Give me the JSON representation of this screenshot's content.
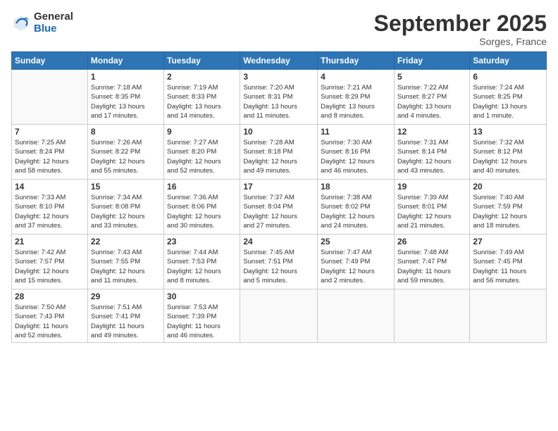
{
  "logo": {
    "general": "General",
    "blue": "Blue"
  },
  "header": {
    "month": "September 2025",
    "location": "Sorges, France"
  },
  "weekdays": [
    "Sunday",
    "Monday",
    "Tuesday",
    "Wednesday",
    "Thursday",
    "Friday",
    "Saturday"
  ],
  "weeks": [
    [
      {
        "day": "",
        "info": ""
      },
      {
        "day": "1",
        "info": "Sunrise: 7:18 AM\nSunset: 8:35 PM\nDaylight: 13 hours\nand 17 minutes."
      },
      {
        "day": "2",
        "info": "Sunrise: 7:19 AM\nSunset: 8:33 PM\nDaylight: 13 hours\nand 14 minutes."
      },
      {
        "day": "3",
        "info": "Sunrise: 7:20 AM\nSunset: 8:31 PM\nDaylight: 13 hours\nand 11 minutes."
      },
      {
        "day": "4",
        "info": "Sunrise: 7:21 AM\nSunset: 8:29 PM\nDaylight: 13 hours\nand 8 minutes."
      },
      {
        "day": "5",
        "info": "Sunrise: 7:22 AM\nSunset: 8:27 PM\nDaylight: 13 hours\nand 4 minutes."
      },
      {
        "day": "6",
        "info": "Sunrise: 7:24 AM\nSunset: 8:25 PM\nDaylight: 13 hours\nand 1 minute."
      }
    ],
    [
      {
        "day": "7",
        "info": "Sunrise: 7:25 AM\nSunset: 8:24 PM\nDaylight: 12 hours\nand 58 minutes."
      },
      {
        "day": "8",
        "info": "Sunrise: 7:26 AM\nSunset: 8:22 PM\nDaylight: 12 hours\nand 55 minutes."
      },
      {
        "day": "9",
        "info": "Sunrise: 7:27 AM\nSunset: 8:20 PM\nDaylight: 12 hours\nand 52 minutes."
      },
      {
        "day": "10",
        "info": "Sunrise: 7:28 AM\nSunset: 8:18 PM\nDaylight: 12 hours\nand 49 minutes."
      },
      {
        "day": "11",
        "info": "Sunrise: 7:30 AM\nSunset: 8:16 PM\nDaylight: 12 hours\nand 46 minutes."
      },
      {
        "day": "12",
        "info": "Sunrise: 7:31 AM\nSunset: 8:14 PM\nDaylight: 12 hours\nand 43 minutes."
      },
      {
        "day": "13",
        "info": "Sunrise: 7:32 AM\nSunset: 8:12 PM\nDaylight: 12 hours\nand 40 minutes."
      }
    ],
    [
      {
        "day": "14",
        "info": "Sunrise: 7:33 AM\nSunset: 8:10 PM\nDaylight: 12 hours\nand 37 minutes."
      },
      {
        "day": "15",
        "info": "Sunrise: 7:34 AM\nSunset: 8:08 PM\nDaylight: 12 hours\nand 33 minutes."
      },
      {
        "day": "16",
        "info": "Sunrise: 7:36 AM\nSunset: 8:06 PM\nDaylight: 12 hours\nand 30 minutes."
      },
      {
        "day": "17",
        "info": "Sunrise: 7:37 AM\nSunset: 8:04 PM\nDaylight: 12 hours\nand 27 minutes."
      },
      {
        "day": "18",
        "info": "Sunrise: 7:38 AM\nSunset: 8:02 PM\nDaylight: 12 hours\nand 24 minutes."
      },
      {
        "day": "19",
        "info": "Sunrise: 7:39 AM\nSunset: 8:01 PM\nDaylight: 12 hours\nand 21 minutes."
      },
      {
        "day": "20",
        "info": "Sunrise: 7:40 AM\nSunset: 7:59 PM\nDaylight: 12 hours\nand 18 minutes."
      }
    ],
    [
      {
        "day": "21",
        "info": "Sunrise: 7:42 AM\nSunset: 7:57 PM\nDaylight: 12 hours\nand 15 minutes."
      },
      {
        "day": "22",
        "info": "Sunrise: 7:43 AM\nSunset: 7:55 PM\nDaylight: 12 hours\nand 11 minutes."
      },
      {
        "day": "23",
        "info": "Sunrise: 7:44 AM\nSunset: 7:53 PM\nDaylight: 12 hours\nand 8 minutes."
      },
      {
        "day": "24",
        "info": "Sunrise: 7:45 AM\nSunset: 7:51 PM\nDaylight: 12 hours\nand 5 minutes."
      },
      {
        "day": "25",
        "info": "Sunrise: 7:47 AM\nSunset: 7:49 PM\nDaylight: 12 hours\nand 2 minutes."
      },
      {
        "day": "26",
        "info": "Sunrise: 7:48 AM\nSunset: 7:47 PM\nDaylight: 11 hours\nand 59 minutes."
      },
      {
        "day": "27",
        "info": "Sunrise: 7:49 AM\nSunset: 7:45 PM\nDaylight: 11 hours\nand 56 minutes."
      }
    ],
    [
      {
        "day": "28",
        "info": "Sunrise: 7:50 AM\nSunset: 7:43 PM\nDaylight: 11 hours\nand 52 minutes."
      },
      {
        "day": "29",
        "info": "Sunrise: 7:51 AM\nSunset: 7:41 PM\nDaylight: 11 hours\nand 49 minutes."
      },
      {
        "day": "30",
        "info": "Sunrise: 7:53 AM\nSunset: 7:39 PM\nDaylight: 11 hours\nand 46 minutes."
      },
      {
        "day": "",
        "info": ""
      },
      {
        "day": "",
        "info": ""
      },
      {
        "day": "",
        "info": ""
      },
      {
        "day": "",
        "info": ""
      }
    ]
  ]
}
